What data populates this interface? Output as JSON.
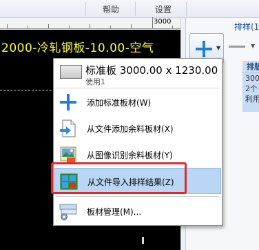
{
  "menubar": {
    "items": [
      "帮助",
      "设置"
    ]
  },
  "ruler": {
    "label": "3000"
  },
  "canvas": {
    "sheet_label": "2000-冷轧钢板-10.00-空气"
  },
  "right_panel": {
    "tab_label": "排样(1",
    "header": "排版",
    "card_lines": [
      "300",
      "2个",
      "利用"
    ]
  },
  "dropdown": {
    "sheet": {
      "title": "标准板 3000.00 x 1230.00",
      "subtitle": "使用1"
    },
    "items": [
      {
        "label": "添加标准板材(W)",
        "icon": "add-plus-icon"
      },
      {
        "label": "从文件添加余料板材(X)",
        "icon": "file-add-icon"
      },
      {
        "label": "从图像识别余料板材(Y)",
        "icon": "image-recognize-icon"
      },
      {
        "label": "从文件导入排样结果(Z)",
        "icon": "import-nesting-icon"
      },
      {
        "label": "板材管理(M)...",
        "icon": "sheet-manage-icon"
      }
    ]
  },
  "colors": {
    "canvas_bg": "#000000",
    "sheet_label": "#ffff33",
    "highlight": "#b9d6f5",
    "annotation_box": "#e8262a",
    "accent": "#1e7fd8"
  }
}
